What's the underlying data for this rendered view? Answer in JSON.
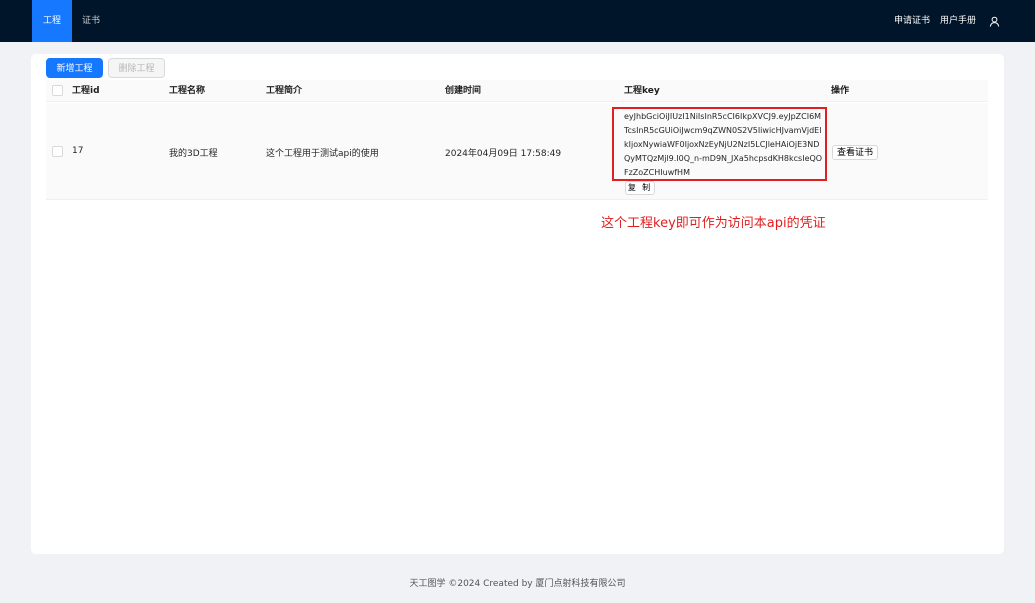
{
  "header": {
    "tabs": [
      {
        "label": "工程",
        "active": true
      },
      {
        "label": "证书",
        "active": false
      }
    ],
    "right_links": [
      "申请证书",
      "用户手册"
    ],
    "user_icon": "user-icon",
    "colors": {
      "bar": "#001529",
      "active_tab": "#1677ff"
    }
  },
  "toolbar": {
    "add_label": "新增工程",
    "delete_label": "删除工程"
  },
  "table": {
    "columns": [
      "工程id",
      "工程名称",
      "工程简介",
      "创建时间",
      "工程key",
      "操作"
    ],
    "rows": [
      {
        "id": "17",
        "name": "我的3D工程",
        "desc": "这个工程用于测试api的使用",
        "created": "2024年04月09日 17:58:49",
        "key": "eyJhbGciOiJIUzI1NiIsInR5cCI6IkpXVCJ9.eyJpZCI6MTcsInR5cGUiOiJwcm9qZWN0S2V5IiwicHJvamVjdElkIjoxNywiaWF0IjoxNzEyNjU2NzI5LCJleHAiOjE3NDQyMTQzMjl9.I0Q_n-mD9N_JXa5hcpsdKH8kcsIeQOFzZoZCHIuwfHM",
        "copy_label": "复 制",
        "action_label": "查看证书"
      }
    ]
  },
  "annotation": "这个工程key即可作为访问本api的凭证",
  "footer": "天工图学 ©2024 Created by 厦门点射科技有限公司"
}
